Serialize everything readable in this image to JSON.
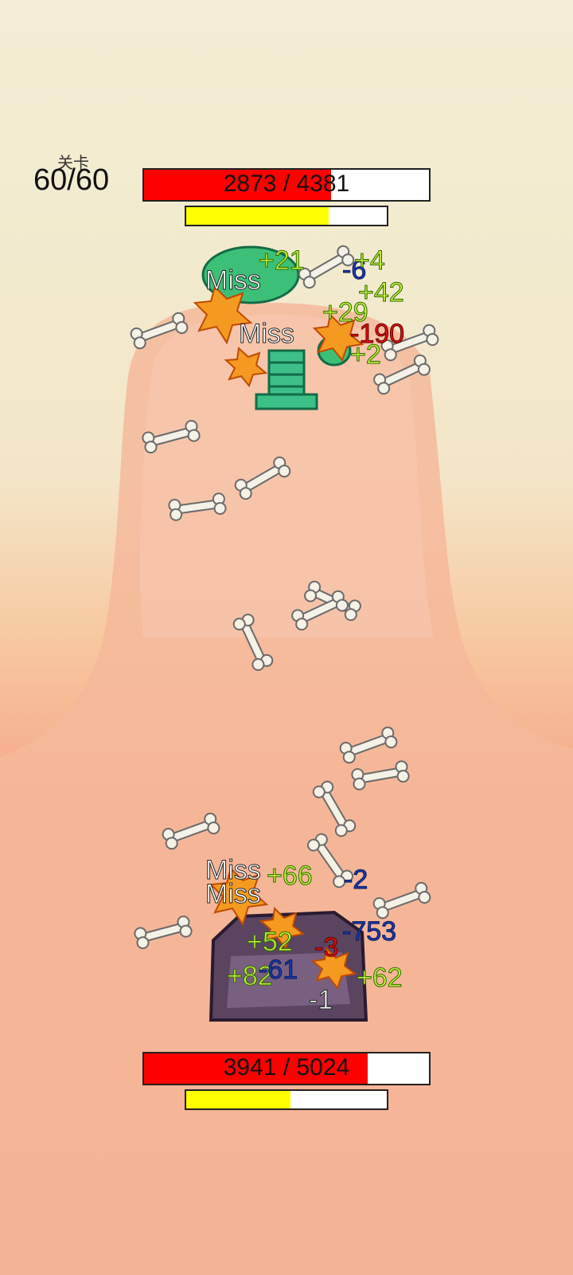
{
  "hud": {
    "level_label": "关卡",
    "level_value": "60/60"
  },
  "enemy": {
    "hp_text": "2873 / 4381",
    "hp_fraction": 0.656,
    "energy_fraction": 0.71
  },
  "player": {
    "hp_text": "3941 / 5024",
    "hp_fraction": 0.784,
    "energy_fraction": 0.52
  },
  "enemy_floating_texts": [
    {
      "text": "+21",
      "kind": "heal"
    },
    {
      "text": "-6",
      "kind": "dmgb"
    },
    {
      "text": "+4",
      "kind": "heal"
    },
    {
      "text": "Miss",
      "kind": "miss"
    },
    {
      "text": "+42",
      "kind": "heal"
    },
    {
      "text": "+29",
      "kind": "heal"
    },
    {
      "text": "Miss",
      "kind": "miss"
    },
    {
      "text": "-190",
      "kind": "dmgr"
    },
    {
      "text": "+2",
      "kind": "heal"
    }
  ],
  "player_floating_texts": [
    {
      "text": "Miss",
      "kind": "miss"
    },
    {
      "text": "+66",
      "kind": "heal"
    },
    {
      "text": "-2",
      "kind": "dmgb"
    },
    {
      "text": "Miss",
      "kind": "miss"
    },
    {
      "text": "-753",
      "kind": "dmgb"
    },
    {
      "text": "+52",
      "kind": "heal"
    },
    {
      "text": "-3",
      "kind": "dmgr"
    },
    {
      "text": "+82",
      "kind": "heal"
    },
    {
      "text": "-61",
      "kind": "dmgb"
    },
    {
      "text": "+62",
      "kind": "heal"
    },
    {
      "text": "-1",
      "kind": "miss"
    }
  ]
}
